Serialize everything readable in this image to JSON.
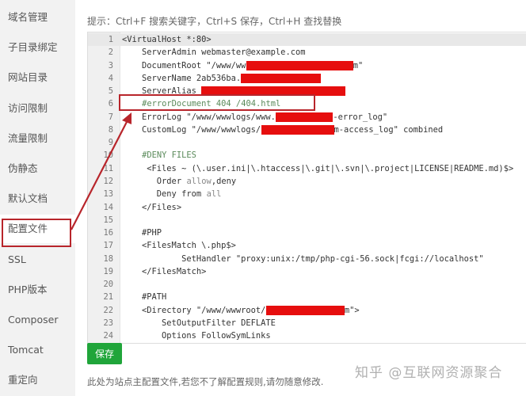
{
  "sidebar": {
    "items": [
      {
        "label": "域名管理"
      },
      {
        "label": "子目录绑定"
      },
      {
        "label": "网站目录"
      },
      {
        "label": "访问限制"
      },
      {
        "label": "流量限制"
      },
      {
        "label": "伪静态"
      },
      {
        "label": "默认文档"
      },
      {
        "label": "配置文件",
        "active": true
      },
      {
        "label": "SSL"
      },
      {
        "label": "PHP版本"
      },
      {
        "label": "Composer"
      },
      {
        "label": "Tomcat"
      },
      {
        "label": "重定向"
      }
    ]
  },
  "hint": "提示：Ctrl+F 搜索关键字，Ctrl+S 保存，Ctrl+H 查找替换",
  "editor": {
    "lines": [
      {
        "n": "1",
        "parts": [
          {
            "t": "<VirtualHost *:80>"
          }
        ]
      },
      {
        "n": "2",
        "parts": [
          {
            "t": "    ServerAdmin webmaster@example.com"
          }
        ]
      },
      {
        "n": "3",
        "parts": [
          {
            "t": "    DocumentRoot \"/www/ww"
          },
          {
            "redact": true
          },
          {
            "t": "m\""
          }
        ]
      },
      {
        "n": "4",
        "parts": [
          {
            "t": "    ServerName 2ab536ba."
          },
          {
            "redact": true
          }
        ]
      },
      {
        "n": "5",
        "parts": [
          {
            "t": "    ServerAlias "
          },
          {
            "redact": true
          }
        ]
      },
      {
        "n": "6",
        "parts": [
          {
            "t": "    "
          },
          {
            "t": "#errorDocument 404 /404.html",
            "cls": "cm"
          }
        ]
      },
      {
        "n": "7",
        "parts": [
          {
            "t": "    ErrorLog \"/www/wwwlogs/www."
          },
          {
            "redact": true
          },
          {
            "t": "-error_log\""
          }
        ]
      },
      {
        "n": "8",
        "parts": [
          {
            "t": "    CustomLog \"/www/wwwlogs/"
          },
          {
            "redact": true
          },
          {
            "t": "m-access_log\" combined"
          }
        ]
      },
      {
        "n": "9",
        "parts": [
          {
            "t": ""
          }
        ]
      },
      {
        "n": "10",
        "parts": [
          {
            "t": "    "
          },
          {
            "t": "#DENY FILES",
            "cls": "cm"
          }
        ]
      },
      {
        "n": "11",
        "parts": [
          {
            "t": "     <Files ~ (\\.user.ini|\\.htaccess|\\.git|\\.svn|\\.project|LICENSE|README.md)$>"
          }
        ]
      },
      {
        "n": "12",
        "parts": [
          {
            "t": "       Order "
          },
          {
            "t": "allow",
            "cls": "kw"
          },
          {
            "t": ",deny"
          }
        ]
      },
      {
        "n": "13",
        "parts": [
          {
            "t": "       Deny from "
          },
          {
            "t": "all",
            "cls": "kw"
          }
        ]
      },
      {
        "n": "14",
        "parts": [
          {
            "t": "    </Files>"
          }
        ]
      },
      {
        "n": "15",
        "parts": [
          {
            "t": ""
          }
        ]
      },
      {
        "n": "16",
        "parts": [
          {
            "t": "    #PHP"
          }
        ]
      },
      {
        "n": "17",
        "parts": [
          {
            "t": "    <FilesMatch \\.php$>"
          }
        ]
      },
      {
        "n": "18",
        "parts": [
          {
            "t": "            SetHandler \"proxy:unix:/tmp/php-cgi-56.sock|fcgi://localhost\""
          }
        ]
      },
      {
        "n": "19",
        "parts": [
          {
            "t": "    </FilesMatch>"
          }
        ]
      },
      {
        "n": "20",
        "parts": [
          {
            "t": ""
          }
        ]
      },
      {
        "n": "21",
        "parts": [
          {
            "t": "    #PATH"
          }
        ]
      },
      {
        "n": "22",
        "parts": [
          {
            "t": "    <Directory \"/www/wwwroot/"
          },
          {
            "redact": true
          },
          {
            "t": "m\">"
          }
        ]
      },
      {
        "n": "23",
        "parts": [
          {
            "t": "        SetOutputFilter DEFLATE"
          }
        ]
      },
      {
        "n": "24",
        "parts": [
          {
            "t": "        Options FollowSymLinks"
          }
        ]
      }
    ]
  },
  "save_label": "保存",
  "footer": "此处为站点主配置文件,若您不了解配置规则,请勿随意修改.",
  "watermark": "知乎 @互联网资源聚合",
  "colors": {
    "accent": "#20a53a",
    "annotation": "#b8252b",
    "redaction": "#e60e0e"
  }
}
